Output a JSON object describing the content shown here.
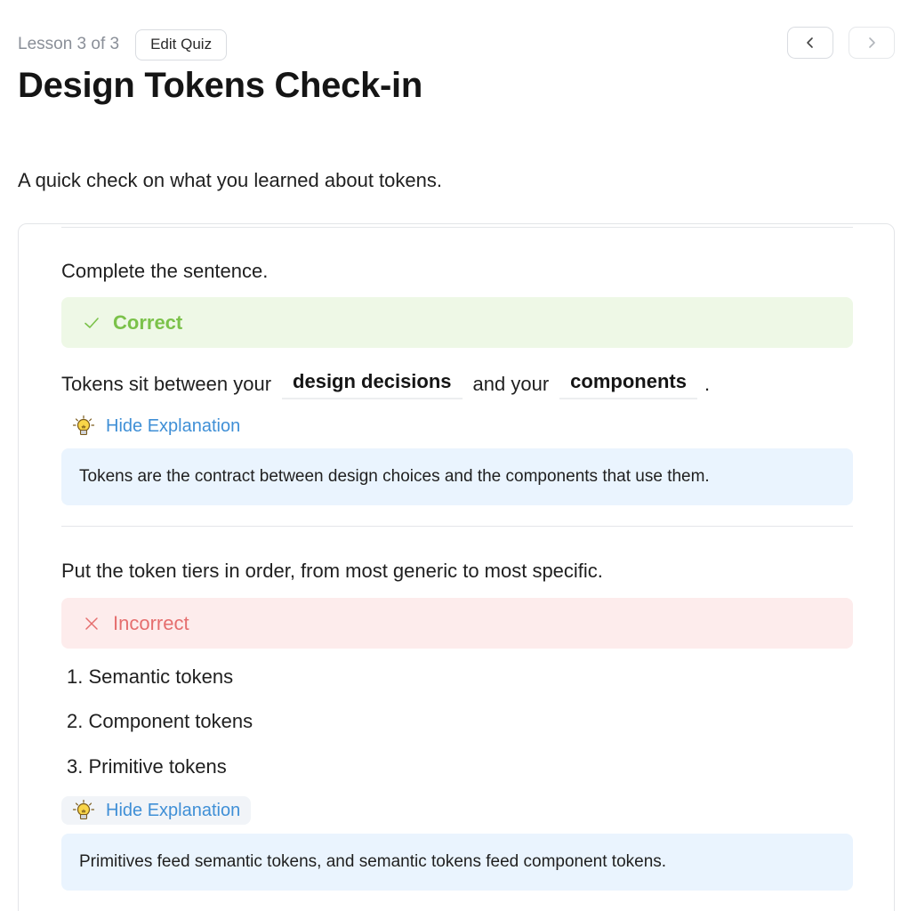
{
  "header": {
    "lesson_label": "Lesson 3 of 3",
    "edit_quiz_label": "Edit Quiz",
    "prev_icon": "chevron-left-icon",
    "next_icon": "chevron-right-icon"
  },
  "page": {
    "title": "Design Tokens Check-in",
    "description": "A quick check on what you learned about tokens."
  },
  "questions": [
    {
      "prompt": "Complete the sentence.",
      "result": "Correct",
      "result_icon": "check-icon",
      "sentence": {
        "part1": "Tokens sit between your",
        "blank1": "design decisions",
        "part2": "and your",
        "blank2": "components",
        "part3": "."
      },
      "explanation_toggle": "Hide Explanation",
      "explanation": "Tokens are the contract between design choices and the components that use them."
    },
    {
      "prompt": "Put the token tiers in order, from most generic to most specific.",
      "result": "Incorrect",
      "result_icon": "x-icon",
      "order": [
        "1. Semantic tokens",
        "2. Component tokens",
        "3. Primitive tokens"
      ],
      "explanation_toggle": "Hide Explanation",
      "explanation": "Primitives feed semantic tokens, and semantic tokens feed component tokens."
    }
  ],
  "colors": {
    "correct": "#7bc24a",
    "correct_bg": "#eef8e6",
    "incorrect": "#e56e6e",
    "incorrect_bg": "#fdecec",
    "link": "#3f8fd6",
    "explanation_bg": "#eaf4fe"
  }
}
